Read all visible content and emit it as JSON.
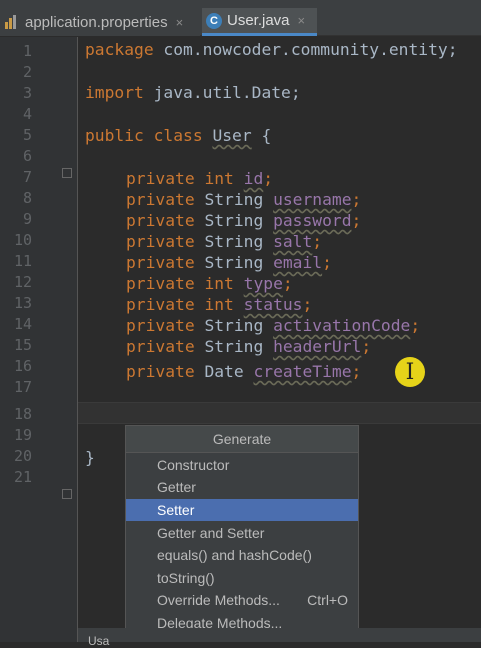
{
  "tabs": [
    {
      "label": "application.properties",
      "close": "×",
      "active": false
    },
    {
      "label": "User.java",
      "close": "×",
      "active": true
    }
  ],
  "line_numbers": [
    "1",
    "2",
    "3",
    "4",
    "5",
    "6",
    "7",
    "8",
    "9",
    "10",
    "11",
    "12",
    "13",
    "14",
    "15",
    "16",
    "17",
    "18",
    "19",
    "20",
    "21"
  ],
  "code": {
    "l1_kw": "package",
    "l1_rest": " com.nowcoder.community.entity;",
    "l3_kw": "import",
    "l3_rest": " java.util.Date;",
    "l5_kw": "public class",
    "l5_name": "User",
    "l5_rest": " {",
    "fields": [
      {
        "kw": "private",
        "type": "int",
        "name": "id"
      },
      {
        "kw": "private",
        "type": "String",
        "name": "username"
      },
      {
        "kw": "private",
        "type": "String",
        "name": "password"
      },
      {
        "kw": "private",
        "type": "String",
        "name": "salt"
      },
      {
        "kw": "private",
        "type": "String",
        "name": "email"
      },
      {
        "kw": "private",
        "type": "int",
        "name": "type"
      },
      {
        "kw": "private",
        "type": "int",
        "name": "status"
      },
      {
        "kw": "private",
        "type": "String",
        "name": "activationCode"
      },
      {
        "kw": "private",
        "type": "String",
        "name": "headerUrl"
      },
      {
        "kw": "private",
        "type": "Date",
        "name": "createTime"
      }
    ],
    "close_brace": "}"
  },
  "cursor_glyph": "I",
  "generate_menu": {
    "title": "Generate",
    "items": [
      {
        "label": "Constructor",
        "shortcut": ""
      },
      {
        "label": "Getter",
        "shortcut": ""
      },
      {
        "label": "Setter",
        "shortcut": "",
        "selected": true
      },
      {
        "label": "Getter and Setter",
        "shortcut": ""
      },
      {
        "label": "equals() and hashCode()",
        "shortcut": ""
      },
      {
        "label": "toString()",
        "shortcut": ""
      },
      {
        "label": "Override Methods...",
        "shortcut": "Ctrl+O"
      },
      {
        "label": "Delegate Methods...",
        "shortcut": ""
      }
    ]
  },
  "bottom_peek_label": "Usa",
  "colors": {
    "keyword": "#cc7832",
    "field": "#9876aa",
    "selection": "#4b6eaf",
    "editor_bg": "#2b2b2b"
  }
}
